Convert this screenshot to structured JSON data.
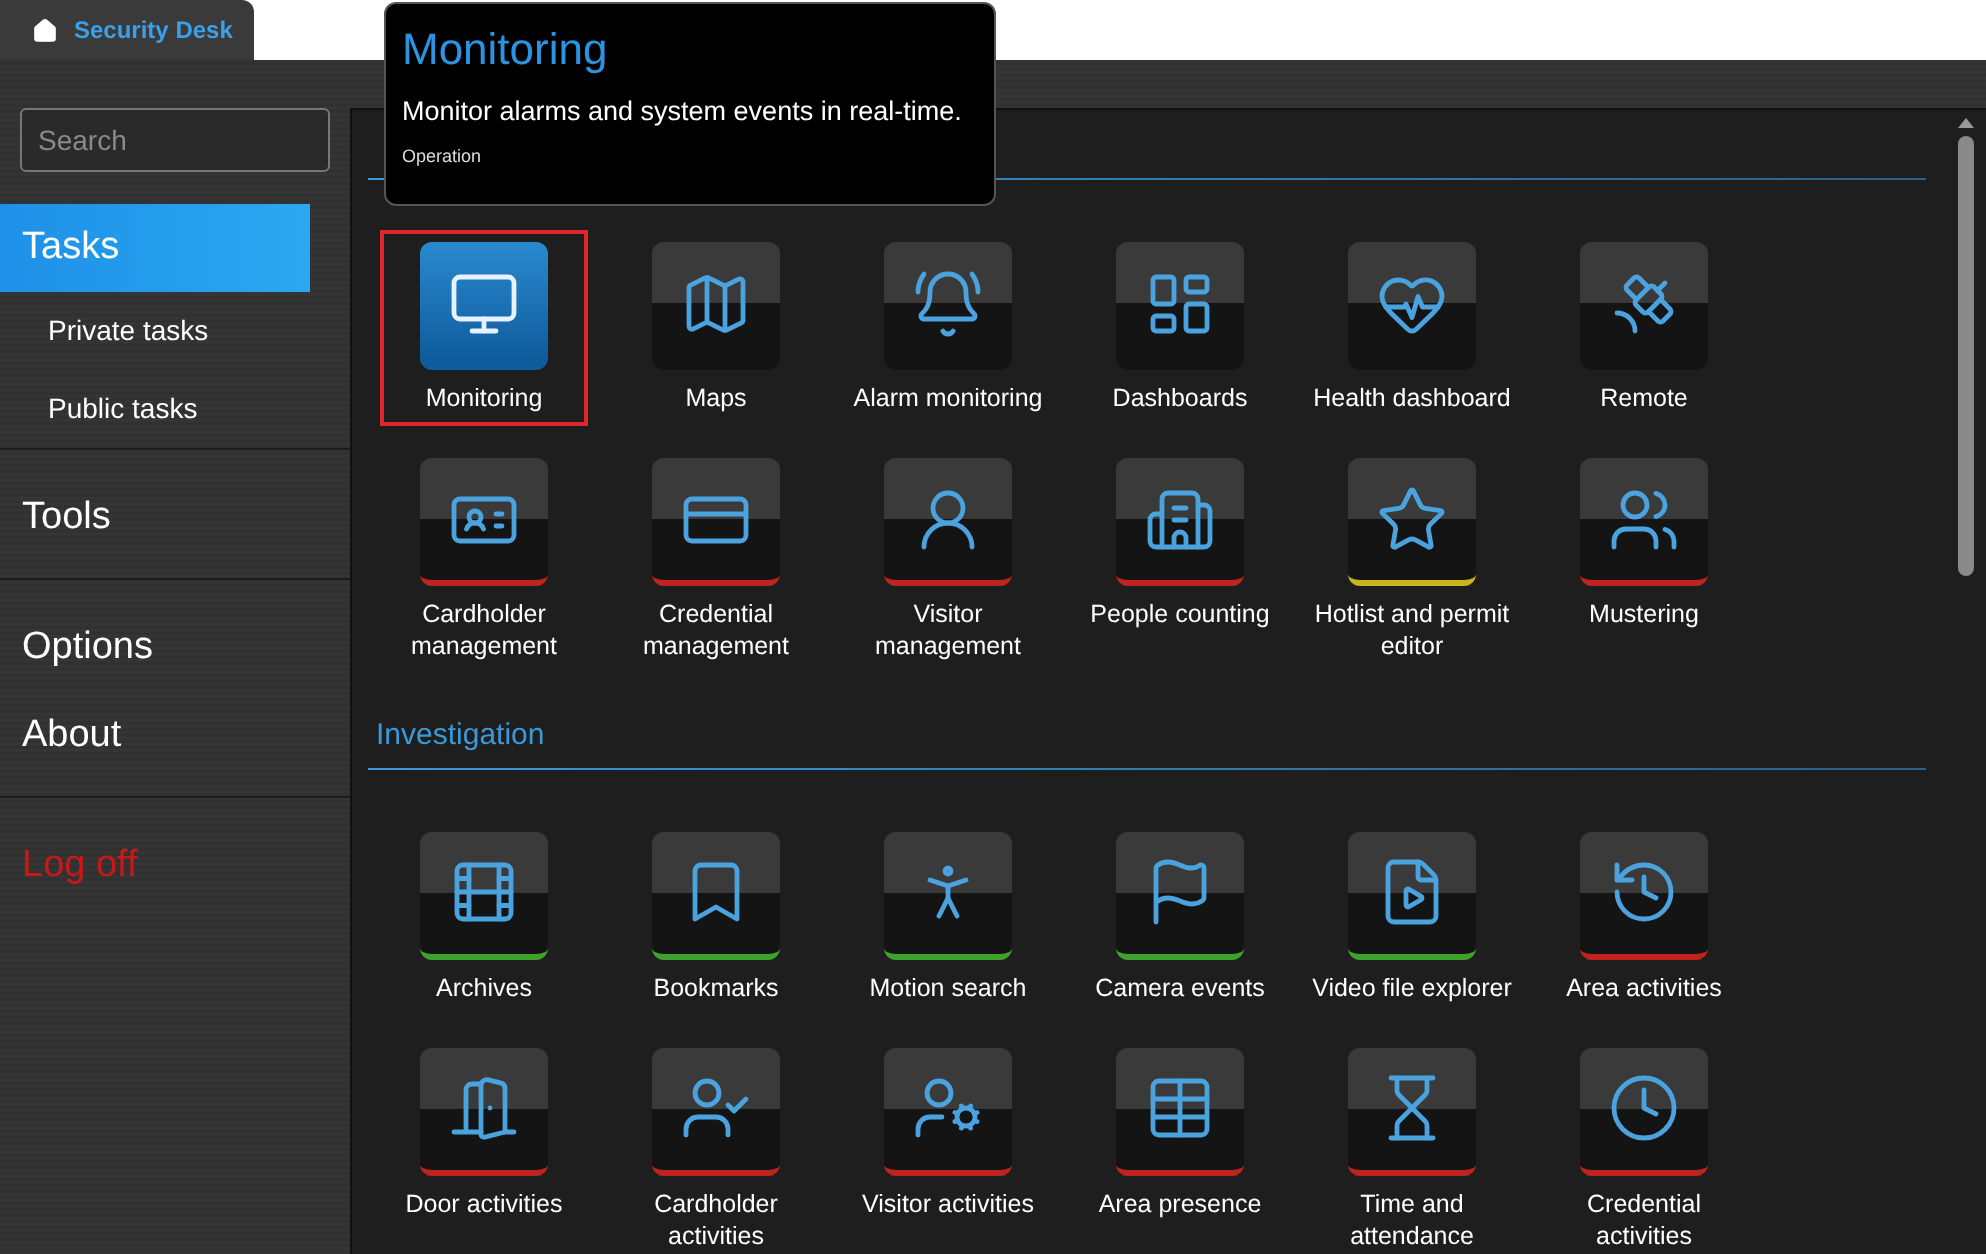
{
  "app_tab": {
    "label": "Security Desk"
  },
  "search": {
    "placeholder": "Search"
  },
  "nav": [
    {
      "groups": [
        {
          "label": "Tasks",
          "selected": true,
          "kind": "main",
          "children": [
            {
              "label": "Private tasks"
            },
            {
              "label": "Public tasks"
            }
          ]
        }
      ]
    },
    {
      "groups": [
        {
          "label": "Tools",
          "selected": false,
          "kind": "main"
        }
      ]
    },
    {
      "groups": [
        {
          "label": "Options",
          "selected": false,
          "kind": "main"
        },
        {
          "label": "About",
          "selected": false,
          "kind": "main"
        }
      ]
    },
    {
      "groups": [
        {
          "label": "Log off",
          "selected": false,
          "kind": "logoff"
        }
      ]
    }
  ],
  "tooltip": {
    "title": "Monitoring",
    "description": "Monitor alarms and system events in real-time.",
    "category": "Operation"
  },
  "sections": [
    {
      "tiles": [
        {
          "label": "Monitoring",
          "selected": true
        },
        {
          "label": "Maps",
          "selected": false
        },
        {
          "label": "Alarm monitoring",
          "selected": false
        },
        {
          "label": "Dashboards",
          "selected": false
        },
        {
          "label": "Health dashboard",
          "selected": false
        },
        {
          "label": "Remote",
          "selected": false
        },
        {
          "label": "Cardholder management",
          "selected": false,
          "color": "#c0221d"
        },
        {
          "label": "Credential management",
          "selected": false,
          "color": "#c0221d"
        },
        {
          "label": "Visitor management",
          "selected": false,
          "color": "#c0221d"
        },
        {
          "label": "People counting",
          "selected": false,
          "color": "#c0221d"
        },
        {
          "label": "Hotlist and permit editor",
          "selected": false,
          "color": "#c9b51c"
        },
        {
          "label": "Mustering",
          "selected": false,
          "color": "#c0221d"
        }
      ]
    },
    {
      "title": "Investigation",
      "tiles": [
        {
          "label": "Archives",
          "selected": false,
          "color": "#3ea32c"
        },
        {
          "label": "Bookmarks",
          "selected": false,
          "color": "#3ea32c"
        },
        {
          "label": "Motion search",
          "selected": false,
          "color": "#3ea32c"
        },
        {
          "label": "Camera events",
          "selected": false,
          "color": "#3ea32c"
        },
        {
          "label": "Video file explorer",
          "selected": false,
          "color": "#3ea32c"
        },
        {
          "label": "Area activities",
          "selected": false,
          "color": "#c0221d"
        },
        {
          "label": "Door activities",
          "selected": false,
          "color": "#c0221d"
        },
        {
          "label": "Cardholder activities",
          "selected": false,
          "color": "#c0221d"
        },
        {
          "label": "Visitor activities",
          "selected": false,
          "color": "#c0221d"
        },
        {
          "label": "Area presence",
          "selected": false,
          "color": "#c0221d"
        },
        {
          "label": "Time and attendance",
          "selected": false,
          "color": "#c0221d"
        },
        {
          "label": "Credential activities",
          "selected": false,
          "color": "#c0221d"
        }
      ]
    }
  ]
}
